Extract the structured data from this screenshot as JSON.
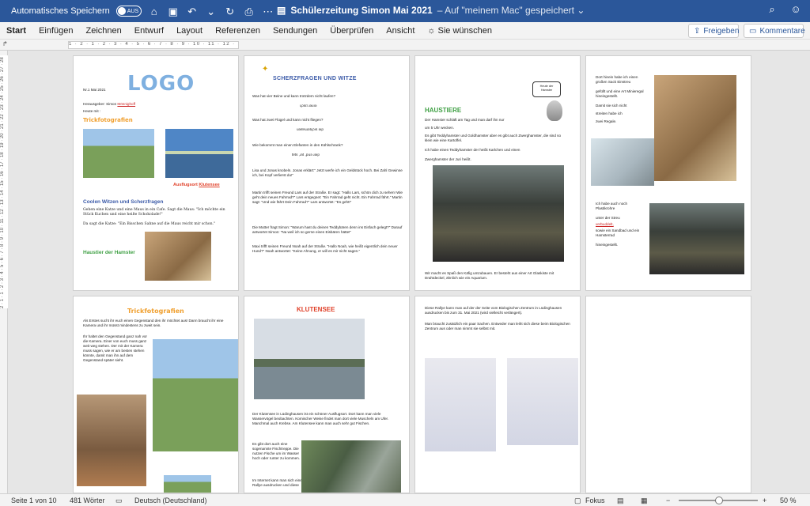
{
  "titlebar": {
    "autosave_label": "Automatisches Speichern",
    "autosave_state": "AUS",
    "document_title": "Schülerzeitung Simon Mai 2021",
    "saved_status": "– Auf \"meinem Mac\" gespeichert ⌄"
  },
  "ribbon": {
    "tabs": [
      "Start",
      "Einfügen",
      "Zeichnen",
      "Entwurf",
      "Layout",
      "Referenzen",
      "Sendungen",
      "Überprüfen",
      "Ansicht"
    ],
    "tell_me": "Sie wünschen",
    "share_label": "Freigeben",
    "comments_label": "Kommentare"
  },
  "ruler": {
    "top_marks": "1 · 2 · 1 · 2 · 3 · 4 · 5 · 6 · 7 · 8 · 9 · 10 · 11 · 12 · 13 · 14 · 15 · 16 · 17 · 18 · 19",
    "left_marks": "2 · 1 · 1 · 2 · 3 · 4 · 5 · 6 · 7 · 8 · 9 · 10 · 11 · 12 · 13 · 14 · 15 · 16 · 17 · 18 · 19 · 20 · 21 · 22 · 23 · 24 · 25 · 26 · 27 · 28"
  },
  "pages": {
    "p1": {
      "issue": "Nr.1 Mai 2021",
      "logo": "LOGO",
      "publisher": "Herausgeber: Simon",
      "publisher_name": "Mönnighoff",
      "today": "Heute mit :",
      "trick_heading": "Trickfotografien",
      "ausflug_label": "Ausflugsort",
      "ausflug_place": "Klutensee",
      "jokes_heading": "Coolen Witzen und Scherzfragen",
      "joke_text": "Gehen eine Katze und eine Maus in ein Cafe. Sagt die Maus: \"Ich möchte ein Stück Kuchen und eine heiße Schokolade!\"",
      "joke_answer": "Da sagt die Katze: \"Ein Bisschen Sahne auf die Maus reicht mir schon.\"",
      "hamster_heading": "Haustier der Hamster"
    },
    "p2": {
      "heading": "SCHERZFRAGEN UND WITZE",
      "q1": "Was hat vier Beine und kann trotzdem nicht laufen?",
      "a1": "ɥɔsıʇ ɹǝuıǝ",
      "q2": "Was hat zwei Flügel und kann nicht fliegen?",
      "a2": "uǝsɐuɹǝʇɥɔıs ǝıp",
      "q3": "Wie bekommt man einen Elefanten in den Kühlschrank?",
      "a3": "ʇɐʇs ,ɹnʇ ,pıɹǝ ɹǝıp",
      "joke1": "Lisa und Jonas knobeln. Jonas erklärt:\" Jetzt werfe ich ein Geldstück hoch. Bei Zahl Gewinne ich, bei Kopf verlierst du!\"",
      "joke2": "Martin trifft seinen Freund Lars auf der Straße. Er sagt: \"Hallo Lars, schön dich zu sehen! Wie geht dein neues Fahrrad?\" Lars entgegnet: \"Ein Fahrrad geht nicht. Ein Fahrrad fährt.\" Martin sagt: \"Und wie fährt Dein Fahrrad?\" Lars antwortet: \"Es geht!\"",
      "joke3": "Die Mutter fragt Simon: \"Warum hast du deinen Teddybären denn ins Eisfach gelegt?\" Darauf antwortet Simon: \"Na weil ich so gerne einen Eisbären hätte!\"",
      "joke4": "Maxi trifft seinen Freund Noah auf der Straße. \"Hallo Noah, wie heißt eigentlich dein neuer Hund?\" Noah antwortet: \"Keine Ahnung, er will es mir nicht sagen.\""
    },
    "p3": {
      "speech": "Heute der Hamster",
      "heading": "HAUSTIERE",
      "line1": "Der Hamster schläft am Tag und man darf ihn nur",
      "line2": "um 5 Uhr wecken.",
      "line3": "Es gibt Teddyhamster und Goldhamster aber es gibt auch Zwerghamster, die sind so klein wie eine Kartoffel.",
      "line4": "Ich habe einen Teddyhamster der heißt Karlchen und einen",
      "line5": "Zwerghamster der Juri heißt.",
      "caption": "Wir macht es Spaß den Käfig umzubauen. Er besteht aus einer Art Glaskiste mit Drahtdeckel, ähnlich wie ein Aquarium."
    },
    "p4": {
      "text1": "Dort hinein habe ich einen großen Sack Einstreu",
      "text2": "gefüllt und eine Art Minieregal hineingestellt.",
      "text3": "Damit sie sich nicht",
      "text4": "streiten habe ich",
      "text5": "zwei Regale.",
      "text6": "Ich habe auch noch Plastikrohre",
      "text7": "unter der Streu",
      "text8": "verbuddelt,",
      "text9": "sowie ein Sandbad und ein Hamsterrad",
      "text10": "hineingestellt."
    },
    "p5": {
      "heading": "Trickfotografien",
      "intro": "Als Erstes sucht ihr euch einen Gegenstand den ihr möchtet aus! Dann braucht ihr eine Kamera und ihr müsst mindestens zu zweit sein.",
      "body": "Ihr haltet den Gegenstand ganz nah vor die Kamera. Einer von euch muss ganz weit weg stehen. Der mit der Kamera muss sagen, wie er am besten stehen könnte, damit man ihn auf dem Gegenstand später sieht."
    },
    "p6": {
      "heading": "KLUTENSEE",
      "text": "Der Klutensee in Lüdinghausen ist ein schöner Ausflugsort. Dort kann man viele Wasservögel beobachten. Komischer Weise findet man dort viele Muscheln am Ufer. Manchmal auch Krebse. Am Klutensee kann man auch sehr gut Fischen.",
      "text2": "Es gibt dort auch eine sogenannte Fischtreppe. Die nutzen Fische um im Wasser hoch oder runter zu kommen.",
      "text3": "Im Internet kann man sich eine Rallye ausdrucken und diese"
    },
    "p7": {
      "text1": "Diese Rallye kann man auf der der Seite vom Biologischen Zentrum in Lüdinghausen ausdrucken bis zum 31. Mai 2021 (wird vielleicht verlängert).",
      "text2": "Man braucht zusätzlich ein paar Sachen. Entweder man leiht sich diese beim Biologischen Zentrum aus oder man nimmt sie selbst mit."
    }
  },
  "statusbar": {
    "page": "Seite 1 von 10",
    "words": "481 Wörter",
    "language": "Deutsch (Deutschland)",
    "focus": "Fokus",
    "zoom_level": "50 %"
  }
}
